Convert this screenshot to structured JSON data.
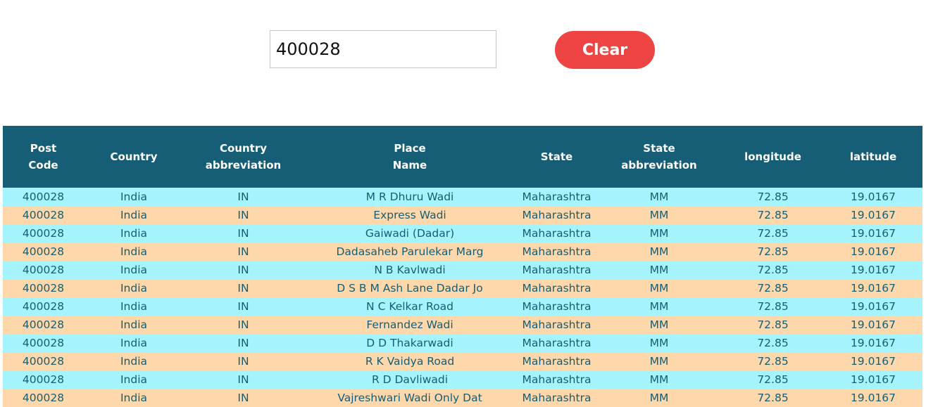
{
  "search": {
    "value": "400028"
  },
  "clear_button": {
    "label": "Clear"
  },
  "colors": {
    "header_bg": "#155e75",
    "row_odd": "#a5f3fc",
    "row_even": "#fed7aa",
    "clear_button": "#ef4444"
  },
  "table": {
    "headers": [
      [
        "Post",
        "Code"
      ],
      [
        "Country"
      ],
      [
        "Country",
        "abbreviation"
      ],
      [
        "Place",
        "Name"
      ],
      [
        "State"
      ],
      [
        "State",
        "abbreviation"
      ],
      [
        "longitude"
      ],
      [
        "latitude"
      ]
    ],
    "rows": [
      [
        "400028",
        "India",
        "IN",
        "M R Dhuru Wadi",
        "Maharashtra",
        "MM",
        "72.85",
        "19.0167"
      ],
      [
        "400028",
        "India",
        "IN",
        "Express Wadi",
        "Maharashtra",
        "MM",
        "72.85",
        "19.0167"
      ],
      [
        "400028",
        "India",
        "IN",
        "Gaiwadi (Dadar)",
        "Maharashtra",
        "MM",
        "72.85",
        "19.0167"
      ],
      [
        "400028",
        "India",
        "IN",
        "Dadasaheb Parulekar Marg",
        "Maharashtra",
        "MM",
        "72.85",
        "19.0167"
      ],
      [
        "400028",
        "India",
        "IN",
        "N B Kavlwadi",
        "Maharashtra",
        "MM",
        "72.85",
        "19.0167"
      ],
      [
        "400028",
        "India",
        "IN",
        "D S B M Ash Lane Dadar Jo",
        "Maharashtra",
        "MM",
        "72.85",
        "19.0167"
      ],
      [
        "400028",
        "India",
        "IN",
        "N C Kelkar Road",
        "Maharashtra",
        "MM",
        "72.85",
        "19.0167"
      ],
      [
        "400028",
        "India",
        "IN",
        "Fernandez Wadi",
        "Maharashtra",
        "MM",
        "72.85",
        "19.0167"
      ],
      [
        "400028",
        "India",
        "IN",
        "D D Thakarwadi",
        "Maharashtra",
        "MM",
        "72.85",
        "19.0167"
      ],
      [
        "400028",
        "India",
        "IN",
        "R K Vaidya Road",
        "Maharashtra",
        "MM",
        "72.85",
        "19.0167"
      ],
      [
        "400028",
        "India",
        "IN",
        "R D Davliwadi",
        "Maharashtra",
        "MM",
        "72.85",
        "19.0167"
      ],
      [
        "400028",
        "India",
        "IN",
        "Vajreshwari Wadi Only Dat",
        "Maharashtra",
        "MM",
        "72.85",
        "19.0167"
      ]
    ]
  }
}
